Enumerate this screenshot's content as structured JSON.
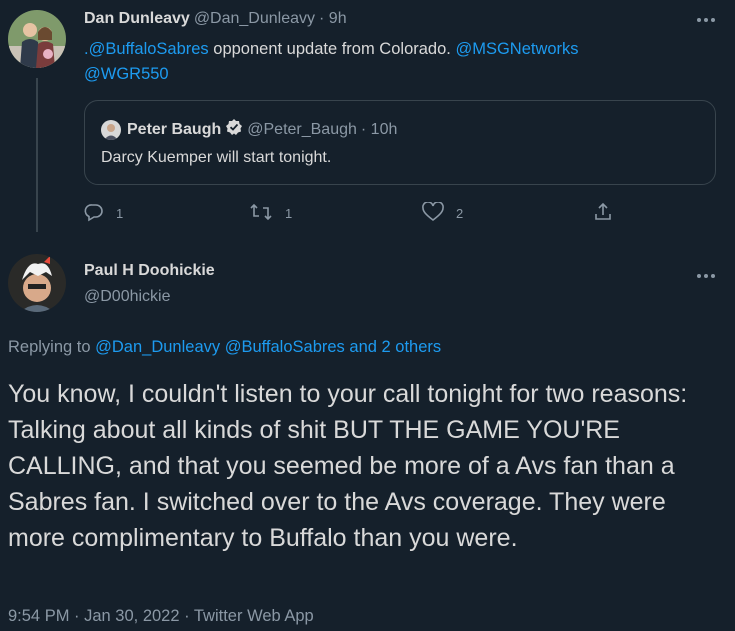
{
  "tweet1": {
    "author_name": "Dan Dunleavy",
    "author_handle": "@Dan_Dunleavy",
    "time": "· 9h",
    "text_mention1": ".@BuffaloSabres",
    "text_mid": " opponent update from Colorado. ",
    "text_mention2": "@MSGNetworks",
    "text_mention3": "@WGR550",
    "quote": {
      "author_name": "Peter Baugh",
      "author_handle": "@Peter_Baugh",
      "time": "· 10h",
      "text": "Darcy Kuemper will start tonight."
    },
    "actions": {
      "reply_count": "1",
      "retweet_count": "1",
      "like_count": "2"
    }
  },
  "tweet2": {
    "author_name": "Paul H Doohickie",
    "author_handle": "@D00hickie",
    "replying_prefix": "Replying to ",
    "replying_targets": "@Dan_Dunleavy @BuffaloSabres",
    "replying_and": " and ",
    "replying_others": "2 others",
    "text": "You know, I couldn't listen to your call tonight for two reasons: Talking about all kinds of shit BUT THE GAME YOU'RE CALLING, and that you seemed be more of a Avs fan than a Sabres fan. I switched over to the Avs coverage. They were more complimentary to Buffalo than you were.",
    "timestamp": "9:54 PM · Jan 30, 2022 · Twitter Web App"
  },
  "colors": {
    "background": "#15202b",
    "link": "#1d9bf0",
    "muted": "#8b98a5",
    "border": "#38444d",
    "text": "#d9d9d9"
  },
  "icons": [
    "reply-icon",
    "retweet-icon",
    "like-icon",
    "share-icon",
    "more-icon",
    "verified-badge-icon"
  ]
}
